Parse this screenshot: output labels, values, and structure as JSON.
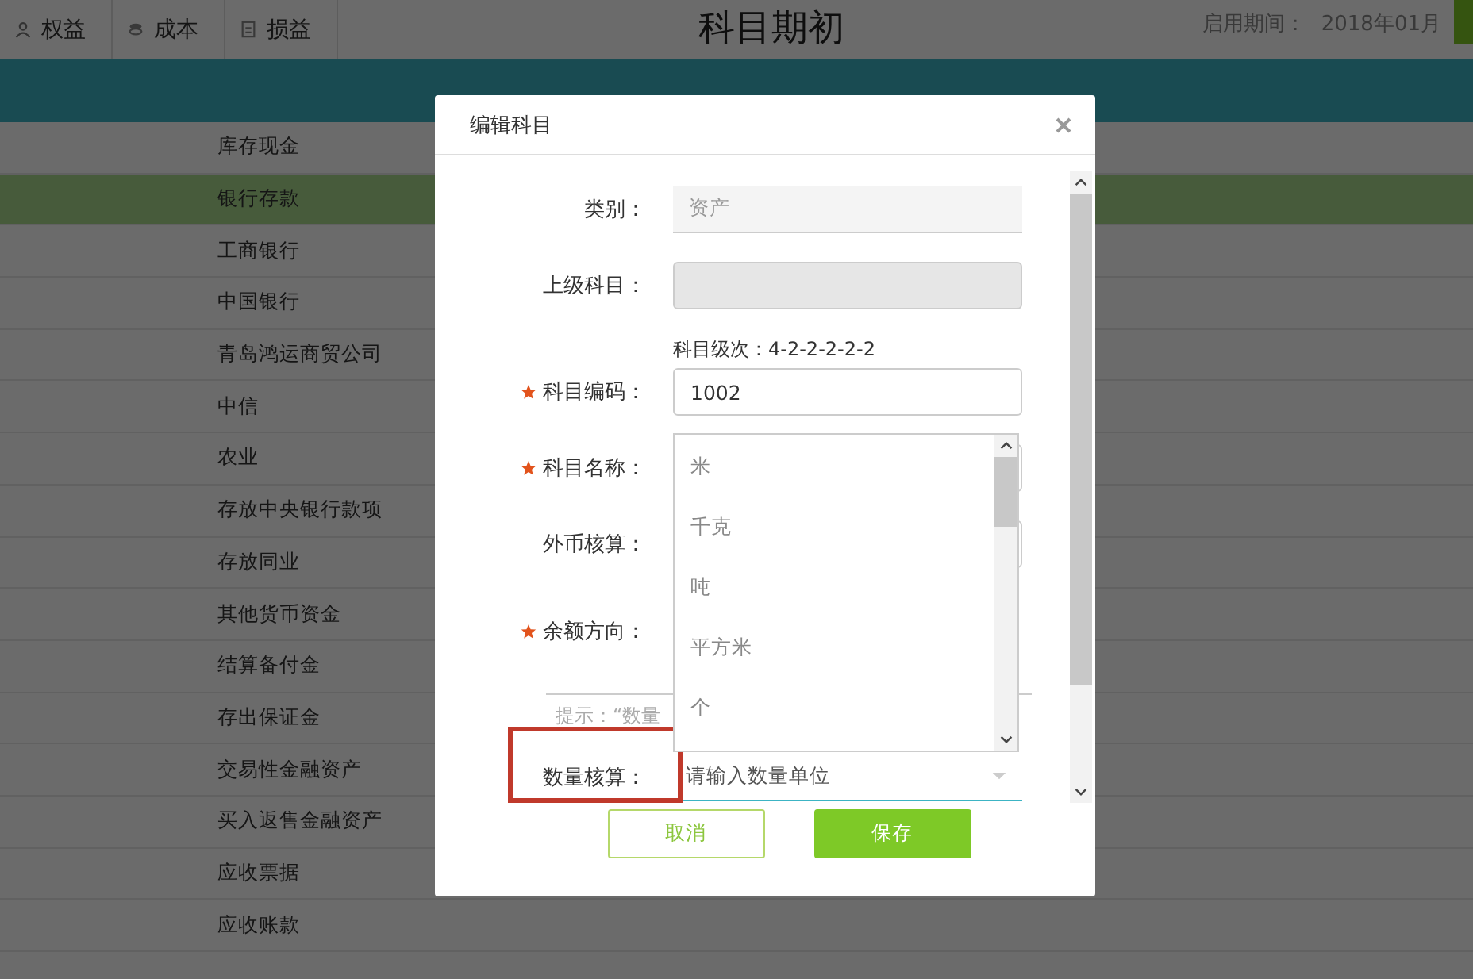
{
  "toolbar": {
    "tabs": [
      {
        "label": "权益"
      },
      {
        "label": "成本"
      },
      {
        "label": "损益"
      }
    ]
  },
  "page_title": "科目期初",
  "period": {
    "label": "启用期间：",
    "value": "2018年01月"
  },
  "table": {
    "rows": [
      {
        "name": "库存现金",
        "selected": false
      },
      {
        "name": "银行存款",
        "selected": true
      },
      {
        "name": "工商银行",
        "selected": false
      },
      {
        "name": "中国银行",
        "selected": false
      },
      {
        "name": "青岛鸿运商贸公司",
        "selected": false
      },
      {
        "name": "中信",
        "selected": false
      },
      {
        "name": "农业",
        "selected": false
      },
      {
        "name": "存放中央银行款项",
        "selected": false
      },
      {
        "name": "存放同业",
        "selected": false
      },
      {
        "name": "其他货币资金",
        "selected": false
      },
      {
        "name": "结算备付金",
        "selected": false
      },
      {
        "name": "存出保证金",
        "selected": false
      },
      {
        "name": "交易性金融资产",
        "selected": false
      },
      {
        "name": "买入返售金融资产",
        "selected": false
      },
      {
        "name": "应收票据",
        "selected": false
      },
      {
        "name": "应收账款",
        "selected": false
      }
    ]
  },
  "dialog": {
    "title": "编辑科目",
    "fields": [
      {
        "kind": "readonly",
        "label": "类别：",
        "required": false,
        "value": "资产"
      },
      {
        "kind": "disabled",
        "label": "上级科目：",
        "required": false
      },
      {
        "kind": "text",
        "label": "科目编码：",
        "required": true,
        "note": "科目级次：4-2-2-2-2-2",
        "value": "1002"
      },
      {
        "kind": "text",
        "label": "科目名称：",
        "required": true
      },
      {
        "kind": "text",
        "label": "外币核算：",
        "required": false
      },
      {
        "kind": "blank",
        "label": "余额方向：",
        "required": true
      },
      {
        "kind": "hint",
        "text": "提示：“数量"
      },
      {
        "kind": "combo",
        "label": "数量核算：",
        "required": false,
        "placeholder": "请输入数量单位",
        "highlighted": true
      }
    ],
    "dropdown": {
      "options": [
        "米",
        "千克",
        "吨",
        "平方米",
        "个"
      ]
    },
    "buttons": [
      {
        "label": "取消",
        "kind": "secondary"
      },
      {
        "label": "保存",
        "kind": "primary"
      }
    ]
  }
}
